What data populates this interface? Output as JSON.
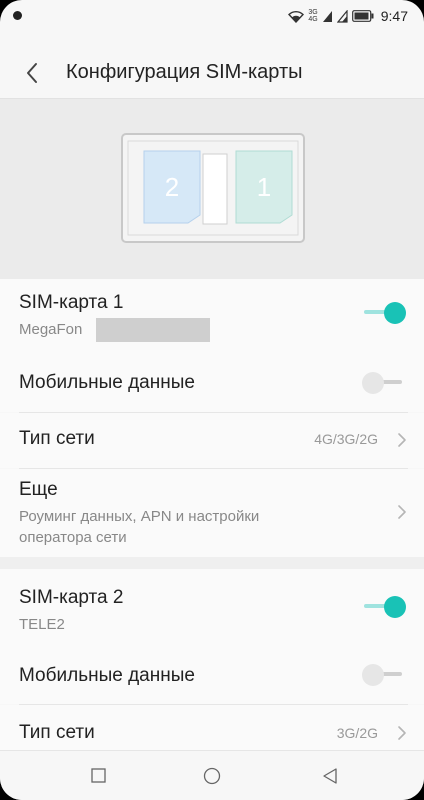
{
  "status_bar": {
    "net_top": "3G",
    "net_bottom": "4G",
    "time": "9:47"
  },
  "header": {
    "title": "Конфигурация SIM-карты"
  },
  "illustration": {
    "slot_2_label": "2",
    "slot_1_label": "1"
  },
  "sim1": {
    "title": "SIM-карта 1",
    "operator": "MegaFon",
    "enabled": true,
    "mobile_data_label": "Мобильные данные",
    "mobile_data_enabled": false,
    "network_type_label": "Тип сети",
    "network_type_value": "4G/3G/2G",
    "more_label": "Еще",
    "more_sub": "Роуминг данных, APN и настройки оператора сети"
  },
  "sim2": {
    "title": "SIM-карта 2",
    "operator": "TELE2",
    "enabled": true,
    "mobile_data_label": "Мобильные данные",
    "mobile_data_enabled": false,
    "network_type_label": "Тип сети",
    "network_type_value": "3G/2G"
  },
  "colors": {
    "accent": "#19c2b6",
    "slot_2": "#d6e8f7",
    "slot_1": "#d5ede9"
  },
  "nav": {
    "recent_icon": "square-icon",
    "home_icon": "circle-icon",
    "back_icon": "triangle-icon"
  }
}
